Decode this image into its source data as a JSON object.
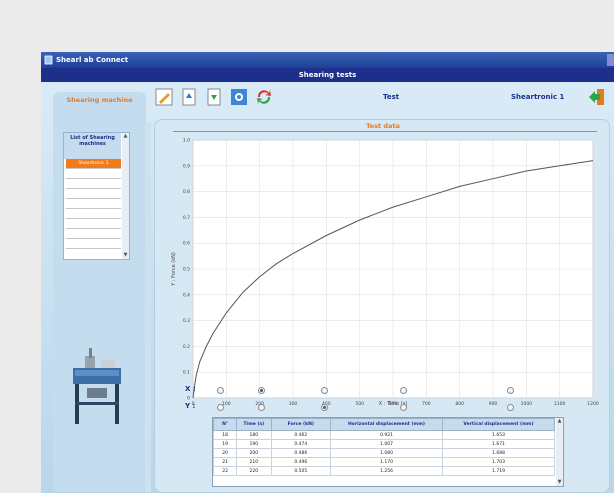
{
  "window": {
    "app_title": "Shearl ab Connect"
  },
  "header": {
    "title": "Shearing tests"
  },
  "sidebar": {
    "title": "Shearing machine",
    "list_header": "List of Shearing machines",
    "items": [
      "Sheartronic 1"
    ]
  },
  "toolbar": {
    "test_label": "Test",
    "machine_label": "Sheartronic 1",
    "icons": [
      "edit-icon",
      "export-icon",
      "import-icon",
      "settings-icon",
      "refresh-icon",
      "exit-icon"
    ]
  },
  "panel": {
    "title": "Test data"
  },
  "chart_data": {
    "type": "line",
    "xlabel": "X : Time (s)",
    "ylabel": "Y : Force (kN)",
    "xlim": [
      0,
      1200
    ],
    "ylim": [
      0,
      1.0
    ],
    "xticks": [
      0,
      100,
      200,
      300,
      400,
      500,
      600,
      700,
      800,
      900,
      1000,
      1100,
      1200
    ],
    "yticks": [
      0,
      0.1,
      0.2,
      0.3,
      0.4,
      0.5,
      0.6,
      0.7,
      0.8,
      0.9,
      1.0
    ],
    "grid": true,
    "x": [
      0,
      5,
      10,
      20,
      40,
      60,
      100,
      150,
      200,
      250,
      300,
      400,
      500,
      600,
      700,
      800,
      900,
      1000,
      1100,
      1200
    ],
    "y": [
      0,
      0.05,
      0.09,
      0.14,
      0.2,
      0.25,
      0.33,
      0.41,
      0.47,
      0.52,
      0.56,
      0.63,
      0.69,
      0.74,
      0.78,
      0.82,
      0.85,
      0.88,
      0.9,
      0.92
    ],
    "color": "#555555"
  },
  "selectors": {
    "x_label": "X :",
    "y_label": "Y :",
    "columns": 5,
    "x_selected": 1,
    "y_selected": 2
  },
  "table": {
    "headers": [
      "N°",
      "Time (s)",
      "Force (kN)",
      "Horizontal displacement (mm)",
      "Vertical displacement (mm)"
    ],
    "rows": [
      [
        "18",
        "180",
        "0.462",
        "0.921",
        "1.653"
      ],
      [
        "19",
        "190",
        "0.474",
        "1.007",
        "1.671"
      ],
      [
        "20",
        "200",
        "0.486",
        "1.080",
        "1.688"
      ],
      [
        "21",
        "210",
        "0.496",
        "1.170",
        "1.703"
      ],
      [
        "22",
        "220",
        "0.505",
        "1.256",
        "1.719"
      ]
    ]
  },
  "colors": {
    "accent_orange": "#e07c2a",
    "title_blue": "#1c2f8a",
    "selected_row": "#f27a18"
  }
}
